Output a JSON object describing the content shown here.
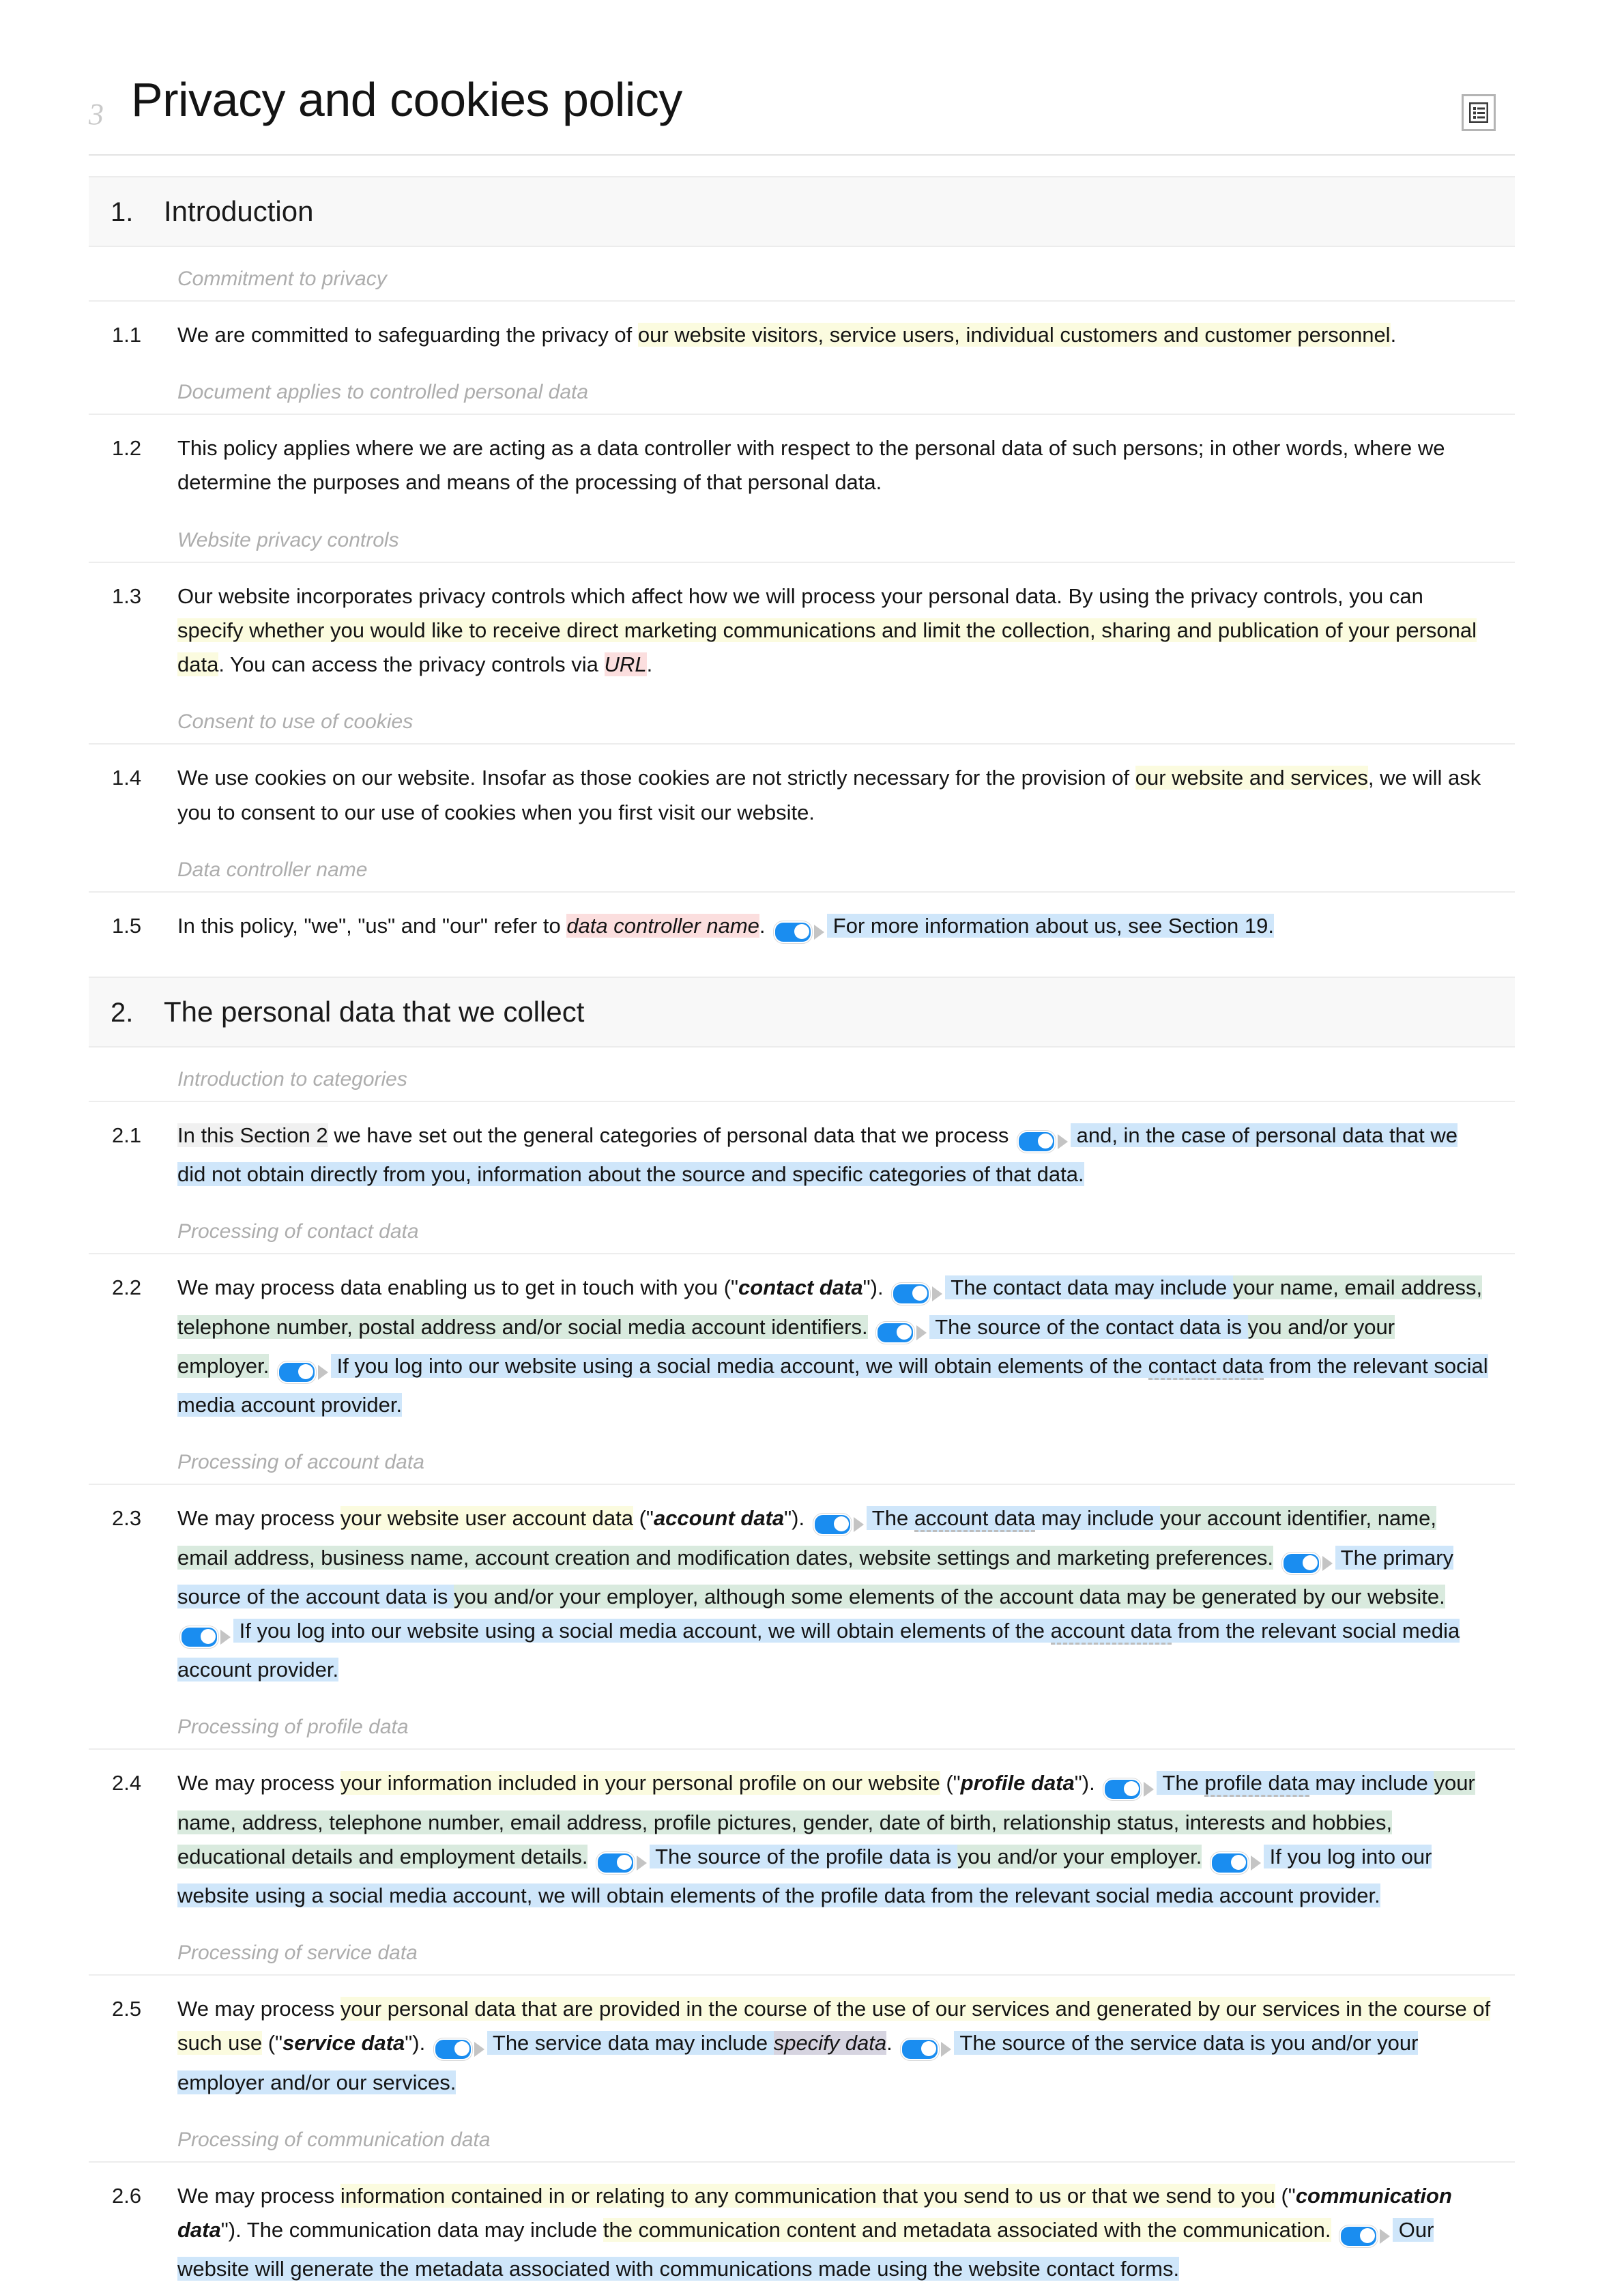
{
  "document": {
    "title": "Privacy and cookies policy",
    "title_mark": "3",
    "toolbar_icon": "document-list-icon"
  },
  "colors": {
    "highlight_yellow": "#fbfbdf",
    "highlight_green": "#d9eade",
    "highlight_blue": "#cfe6fa",
    "highlight_pink": "#fbdede",
    "highlight_grey": "#f0f0f0",
    "highlight_lavender": "#d6d4e0",
    "toggle_on": "#1a8df0",
    "section_header_bg": "#f8f8f8",
    "guidance_text": "#adadad"
  },
  "sections": [
    {
      "number": "1.",
      "title": "Introduction",
      "blocks": [
        {
          "guidance": "Commitment to privacy",
          "clause_number": "1.1",
          "runs": [
            {
              "text": "We are committed to safeguarding the privacy of ",
              "style": "plain"
            },
            {
              "text": "our website visitors, service users, individual customers and customer personnel",
              "style": "yellow"
            },
            {
              "text": ".",
              "style": "plain"
            }
          ]
        },
        {
          "guidance": "Document applies to controlled personal data",
          "clause_number": "1.2",
          "runs": [
            {
              "text": "This policy applies where we are acting as a data controller with respect to the personal data of such persons; in other words, where we determine the purposes and means of the processing of that personal data.",
              "style": "plain"
            }
          ]
        },
        {
          "guidance": "Website privacy controls",
          "clause_number": "1.3",
          "runs": [
            {
              "text": "Our website incorporates privacy controls which affect how we will process your personal data. By using the privacy controls, you can ",
              "style": "plain"
            },
            {
              "text": "specify whether you would like to receive direct marketing communications and limit the collection, sharing and publication of your personal data",
              "style": "yellow"
            },
            {
              "text": ". You can access the privacy controls via ",
              "style": "plain"
            },
            {
              "text": "URL",
              "style": "pink-italic"
            },
            {
              "text": ".",
              "style": "plain"
            }
          ]
        },
        {
          "guidance": "Consent to use of cookies",
          "clause_number": "1.4",
          "runs": [
            {
              "text": "We use cookies on our website. Insofar as those cookies are not strictly necessary for the provision of ",
              "style": "plain"
            },
            {
              "text": "our website and services",
              "style": "yellow"
            },
            {
              "text": ", we will ask you to consent to our use of cookies when you first visit our website.",
              "style": "plain"
            }
          ]
        },
        {
          "guidance": "Data controller name",
          "clause_number": "1.5",
          "runs": [
            {
              "text": "In this policy, \"we\", \"us\" and \"our\" refer to ",
              "style": "plain"
            },
            {
              "text": "data controller name",
              "style": "pink-italic"
            },
            {
              "text": ". ",
              "style": "plain"
            },
            {
              "style": "toggle"
            },
            {
              "text": " For more information about us, see Section 19.",
              "style": "blue"
            }
          ]
        }
      ]
    },
    {
      "number": "2.",
      "title": "The personal data that we collect",
      "blocks": [
        {
          "guidance": "Introduction to categories",
          "clause_number": "2.1",
          "runs": [
            {
              "text": "In this Section 2",
              "style": "grey"
            },
            {
              "text": " we have set out the general categories of personal data that we process ",
              "style": "plain"
            },
            {
              "style": "toggle"
            },
            {
              "text": " and, in the case of personal data that we did not obtain directly from you, information about the source and specific categories of that data.",
              "style": "blue"
            }
          ]
        },
        {
          "guidance": "Processing of contact data",
          "clause_number": "2.2",
          "runs": [
            {
              "text": "We may process data enabling us to get in touch with you (\"",
              "style": "plain"
            },
            {
              "text": "contact data",
              "style": "bold-term"
            },
            {
              "text": "\"). ",
              "style": "plain"
            },
            {
              "style": "toggle"
            },
            {
              "text": " The contact data may include ",
              "style": "blue"
            },
            {
              "text": "your name, email address, telephone number, postal address and/or social media account identifiers.",
              "style": "green"
            },
            {
              "text": " ",
              "style": "plain"
            },
            {
              "style": "toggle"
            },
            {
              "text": " The source of the contact data is ",
              "style": "blue"
            },
            {
              "text": "you and/or your employer.",
              "style": "green"
            },
            {
              "text": " ",
              "style": "plain"
            },
            {
              "style": "toggle"
            },
            {
              "text": " If you log into our website using a social media account, we will obtain elements of the ",
              "style": "blue"
            },
            {
              "text": "contact data",
              "style": "blue-dashed"
            },
            {
              "text": " from the relevant social media account provider.",
              "style": "blue"
            }
          ]
        },
        {
          "guidance": "Processing of account data",
          "clause_number": "2.3",
          "runs": [
            {
              "text": "We may process ",
              "style": "plain"
            },
            {
              "text": "your website user account data",
              "style": "yellow"
            },
            {
              "text": " (\"",
              "style": "plain"
            },
            {
              "text": "account data",
              "style": "bold-term"
            },
            {
              "text": "\"). ",
              "style": "plain"
            },
            {
              "style": "toggle"
            },
            {
              "text": " The ",
              "style": "blue"
            },
            {
              "text": "account data",
              "style": "blue-dashed"
            },
            {
              "text": " may include ",
              "style": "blue"
            },
            {
              "text": "your account identifier, name, email address, business name, account creation and modification dates, website settings and marketing preferences.",
              "style": "green"
            },
            {
              "text": " ",
              "style": "plain"
            },
            {
              "style": "toggle"
            },
            {
              "text": " The primary source of the account data is ",
              "style": "blue"
            },
            {
              "text": "you and/or your employer, although some elements of the account data may be generated by our website.",
              "style": "green"
            },
            {
              "text": " ",
              "style": "plain"
            },
            {
              "style": "toggle"
            },
            {
              "text": " If you log into our website using a social media account, we will obtain elements of the ",
              "style": "blue"
            },
            {
              "text": "account data",
              "style": "blue-dashed"
            },
            {
              "text": " from the relevant social media account provider.",
              "style": "blue"
            }
          ]
        },
        {
          "guidance": "Processing of profile data",
          "clause_number": "2.4",
          "runs": [
            {
              "text": "We may process ",
              "style": "plain"
            },
            {
              "text": "your information included in your personal profile on our website",
              "style": "yellow"
            },
            {
              "text": " (\"",
              "style": "plain"
            },
            {
              "text": "profile data",
              "style": "bold-term"
            },
            {
              "text": "\"). ",
              "style": "plain"
            },
            {
              "style": "toggle"
            },
            {
              "text": " The ",
              "style": "blue"
            },
            {
              "text": "profile data",
              "style": "blue-dashed"
            },
            {
              "text": " may include ",
              "style": "blue"
            },
            {
              "text": "your name, address, telephone number, email address, profile pictures, gender, date of birth, relationship status, interests and hobbies, educational details and employment details.",
              "style": "green"
            },
            {
              "text": " ",
              "style": "plain"
            },
            {
              "style": "toggle"
            },
            {
              "text": " The source of the profile data is ",
              "style": "blue"
            },
            {
              "text": "you and/or your employer.",
              "style": "green"
            },
            {
              "text": " ",
              "style": "plain"
            },
            {
              "style": "toggle"
            },
            {
              "text": " If you log into our website using a social media account, we will obtain elements of the profile data from the relevant social media account provider.",
              "style": "blue"
            }
          ]
        },
        {
          "guidance": "Processing of service data",
          "clause_number": "2.5",
          "runs": [
            {
              "text": "We may process ",
              "style": "plain"
            },
            {
              "text": "your personal data that are provided in the course of the use of our services and generated by our services in the course of such use",
              "style": "yellow"
            },
            {
              "text": " (\"",
              "style": "plain"
            },
            {
              "text": "service data",
              "style": "bold-term"
            },
            {
              "text": "\"). ",
              "style": "plain"
            },
            {
              "style": "toggle"
            },
            {
              "text": " The service data may include ",
              "style": "blue"
            },
            {
              "text": "specify data",
              "style": "lavender-italic"
            },
            {
              "text": ". ",
              "style": "plain"
            },
            {
              "style": "toggle"
            },
            {
              "text": " The source of the service data is ",
              "style": "blue"
            },
            {
              "text": "you and/or your employer and/or our services.",
              "style": "blue"
            }
          ]
        },
        {
          "guidance": "Processing of communication data",
          "clause_number": "2.6",
          "runs": [
            {
              "text": "We may process ",
              "style": "plain"
            },
            {
              "text": "information contained in or relating to any communication that you send to us or that we send to you",
              "style": "yellow"
            },
            {
              "text": " (\"",
              "style": "plain"
            },
            {
              "text": "communication data",
              "style": "bold-term"
            },
            {
              "text": "\"). The communication data may include ",
              "style": "plain"
            },
            {
              "text": "the communication content and metadata associated with the communication.",
              "style": "yellow"
            },
            {
              "text": " ",
              "style": "plain"
            },
            {
              "style": "toggle"
            },
            {
              "text": " Our website will generate the metadata associated with communications made using the website contact forms.",
              "style": "blue"
            }
          ]
        }
      ]
    }
  ]
}
